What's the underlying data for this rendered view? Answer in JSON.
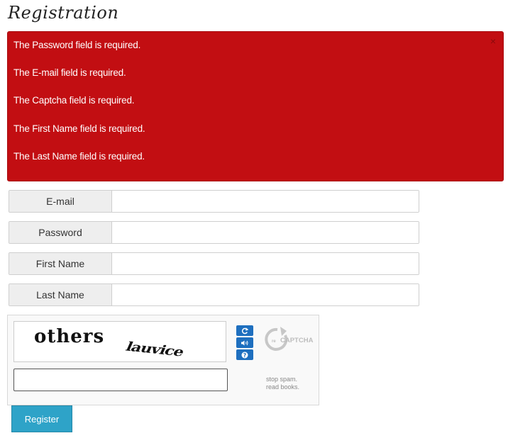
{
  "page": {
    "title": "Registration"
  },
  "alert": {
    "close_symbol": "×",
    "errors": [
      "The Password field is required.",
      "The E-mail field is required.",
      "The Captcha field is required.",
      "The First Name field is required.",
      "The Last Name field is required."
    ]
  },
  "form": {
    "fields": [
      {
        "label": "E-mail",
        "value": ""
      },
      {
        "label": "Password",
        "value": ""
      },
      {
        "label": "First Name",
        "value": ""
      },
      {
        "label": "Last Name",
        "value": ""
      }
    ]
  },
  "captcha": {
    "word1": "others",
    "word2": "lauvice",
    "logo_text": "CAPTCHA",
    "logo_prefix": "re",
    "tagline_line1": "stop spam.",
    "tagline_line2": "read books.",
    "input_value": "",
    "button_color": "#1e6fbf",
    "icons": [
      "refresh-icon",
      "audio-icon",
      "help-icon"
    ]
  },
  "actions": {
    "register_label": "Register",
    "register_color": "#2ea3c8"
  },
  "colors": {
    "alert_bg": "#c20e12"
  }
}
